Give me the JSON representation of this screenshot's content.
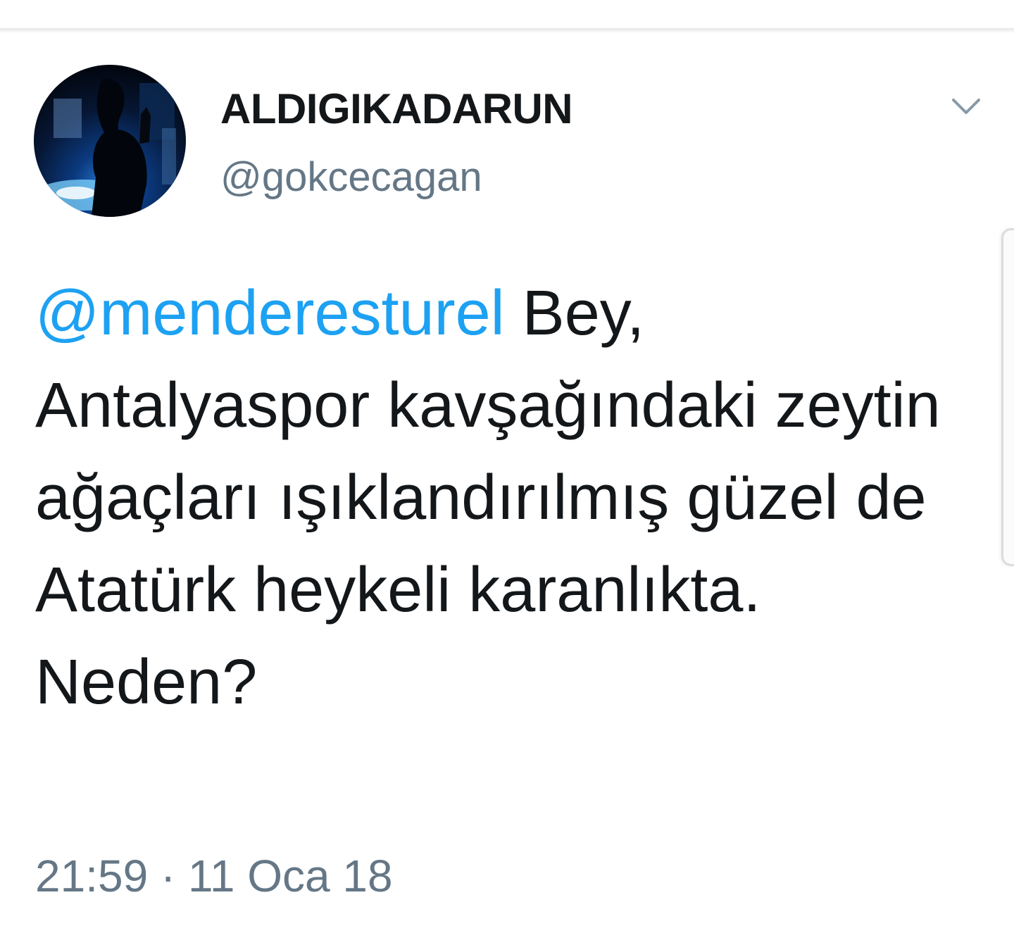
{
  "tweet": {
    "display_name": "ALDIGIKADARUN",
    "handle": "@gokcecagan",
    "mention": "@menderesturel",
    "text": " Bey, Antalyaspor kavşağındaki zeytin ağaçları ışıklandırılmış güzel de Atatürk heykeli karanlıkta. Neden?",
    "timestamp": "21:59 · 11 Oca 18",
    "avatar_icon": "profile-photo",
    "menu_icon": "chevron-down-icon"
  },
  "colors": {
    "text": "#14171a",
    "secondary": "#657786",
    "link": "#1da1f2",
    "background": "#ffffff"
  }
}
